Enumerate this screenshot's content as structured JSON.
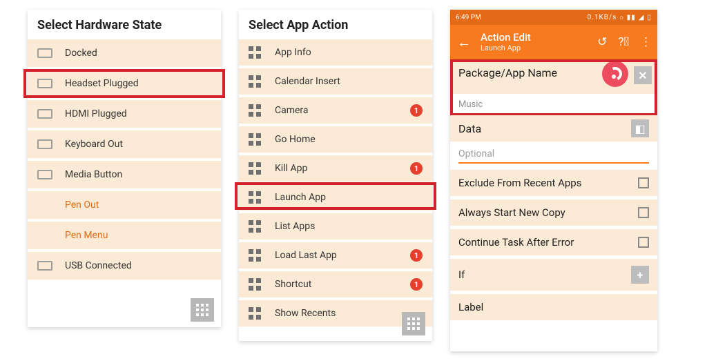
{
  "panel1": {
    "title": "Select Hardware State",
    "items": [
      {
        "label": "Docked",
        "sub": false
      },
      {
        "label": "Headset Plugged",
        "sub": false
      },
      {
        "label": "HDMI Plugged",
        "sub": false
      },
      {
        "label": "Keyboard Out",
        "sub": false
      },
      {
        "label": "Media Button",
        "sub": false
      },
      {
        "label": "Pen Out",
        "sub": true
      },
      {
        "label": "Pen Menu",
        "sub": true
      },
      {
        "label": "USB Connected",
        "sub": false
      }
    ],
    "highlight_index": 1
  },
  "panel2": {
    "title": "Select App Action",
    "items": [
      {
        "label": "App Info",
        "badge": null
      },
      {
        "label": "Calendar Insert",
        "badge": null
      },
      {
        "label": "Camera",
        "badge": "1"
      },
      {
        "label": "Go Home",
        "badge": null
      },
      {
        "label": "Kill App",
        "badge": "1"
      },
      {
        "label": "Launch App",
        "badge": null
      },
      {
        "label": "List Apps",
        "badge": null
      },
      {
        "label": "Load Last App",
        "badge": "1"
      },
      {
        "label": "Shortcut",
        "badge": "1"
      },
      {
        "label": "Show Recents",
        "badge": null
      }
    ],
    "highlight_index": 5
  },
  "panel3": {
    "status": {
      "time": "6:49 PM",
      "net": "0.1KB/s"
    },
    "appbar": {
      "title": "Action Edit",
      "subtitle": "Launch App"
    },
    "section_package": "Package/App Name",
    "app_name": "Music",
    "section_data": "Data",
    "data_placeholder": "Optional",
    "rows": [
      "Exclude From Recent Apps",
      "Always Start New Copy",
      "Continue Task After Error"
    ],
    "if_label": "If",
    "label_label": "Label"
  }
}
